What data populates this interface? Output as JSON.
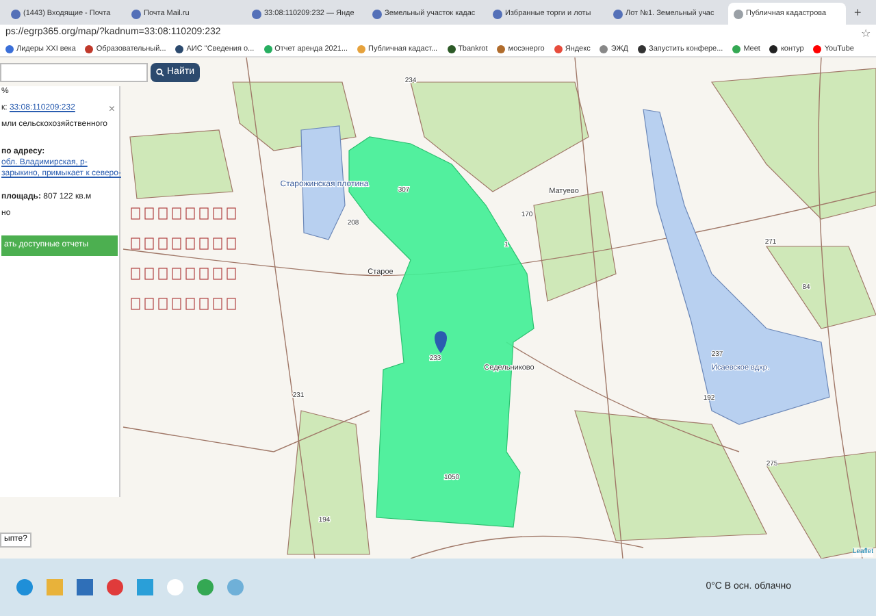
{
  "browser": {
    "tabs": [
      {
        "label": "(1443) Входящие - Почта",
        "selected": false
      },
      {
        "label": "Почта Mail.ru",
        "selected": false
      },
      {
        "label": "33:08:110209:232 — Янде",
        "selected": false
      },
      {
        "label": "Земельный участок кадас",
        "selected": false
      },
      {
        "label": "Избранные торги и лоты",
        "selected": false
      },
      {
        "label": "Лот №1. Земельный учас",
        "selected": false
      },
      {
        "label": "Публичная кадастрова",
        "selected": true
      }
    ],
    "new_tab": "+",
    "address": "ps://egrp365.org/map/?kadnum=33:08:110209:232",
    "bookmark_star": "☆",
    "bookmarks": [
      "Лидеры XXI века",
      "Образовательный...",
      "АИС \"Сведения о...",
      "Отчет аренда 2021...",
      "Публичная кадаст...",
      "Tbankrot",
      "мосэнерго",
      "Яндекс",
      "ЭЖД",
      "Запустить конфере...",
      "Meet",
      "контур",
      "YouTube"
    ]
  },
  "search": {
    "button": "Найти"
  },
  "info_panel": {
    "percent": "%",
    "cadnum_label": "к:",
    "cadnum": "33:08:110209:232",
    "close": "×",
    "category": "мли сельскохозяйственного",
    "address_label": "по адресу:",
    "address_lines": [
      "обл. Владимирская, р-",
      "зарыкино, примыкает к северо-"
    ],
    "area_label": "площадь:",
    "area": "807 122 кв.м",
    "status": "но",
    "reports_button": "ать доступные отчеты"
  },
  "hint": "ыпте?",
  "map": {
    "labels": [
      "Старожинская плотина",
      "Старое",
      "Матуево",
      "Седельниково",
      "Исаевское вдхр.",
      "231",
      "233",
      "237",
      "271",
      "275",
      "194",
      "192",
      "1050",
      "208",
      "170",
      "84",
      "307",
      "234",
      "1"
    ]
  },
  "attribution": "Leaflet",
  "taskbar": {
    "weather": "0°C  В осн. облачно"
  }
}
